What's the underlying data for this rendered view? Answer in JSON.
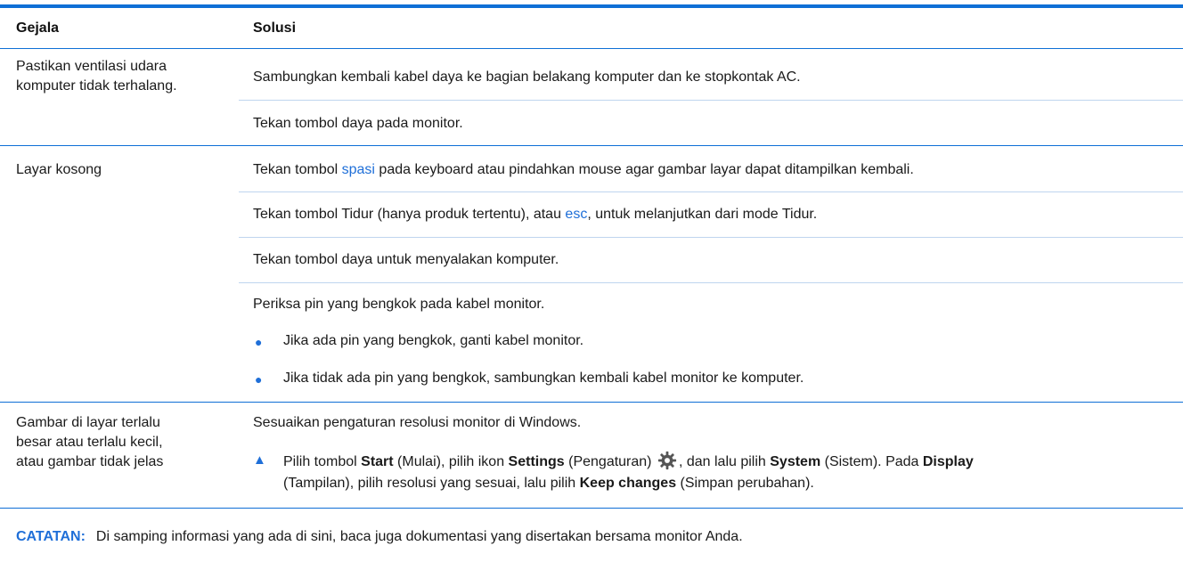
{
  "table": {
    "headers": {
      "col1": "Gejala",
      "col2": "Solusi"
    },
    "row1": {
      "symptom_l1": "Pastikan ventilasi udara",
      "symptom_l2": "komputer tidak terhalang.",
      "sol1": "Sambungkan kembali kabel daya ke bagian belakang komputer dan ke stopkontak AC.",
      "sol2": "Tekan tombol daya pada monitor."
    },
    "row2": {
      "symptom": "Layar kosong",
      "sol1_pre": "Tekan tombol ",
      "sol1_key": "spasi",
      "sol1_post": " pada keyboard atau pindahkan mouse agar gambar layar dapat ditampilkan kembali.",
      "sol2_pre": "Tekan tombol Tidur (hanya produk tertentu), atau ",
      "sol2_key": "esc",
      "sol2_post": ", untuk melanjutkan dari mode Tidur.",
      "sol3": "Tekan tombol daya untuk menyalakan komputer.",
      "sol4": "Periksa pin yang bengkok pada kabel monitor.",
      "bullet1": "Jika ada pin yang bengkok, ganti kabel monitor.",
      "bullet2": "Jika tidak ada pin yang bengkok, sambungkan kembali kabel monitor ke komputer."
    },
    "row3": {
      "symptom_l1": "Gambar di layar terlalu",
      "symptom_l2": "besar atau terlalu kecil,",
      "symptom_l3": "atau gambar tidak jelas",
      "sol1": "Sesuaikan pengaturan resolusi monitor di Windows.",
      "step": {
        "t1": "Pilih tombol ",
        "b1": "Start",
        "t2": " (Mulai), pilih ikon ",
        "b2": "Settings",
        "t3": " (Pengaturan) ",
        "t4": ", dan lalu pilih ",
        "b3": "System",
        "t5": " (Sistem). Pada ",
        "b4": "Display",
        "t6": "(Tampilan), pilih resolusi yang sesuai, lalu pilih ",
        "b5": "Keep changes",
        "t7": " (Simpan perubahan)."
      }
    }
  },
  "note": {
    "label": "CATATAN:",
    "text": "Di samping informasi yang ada di sini, baca juga dokumentasi yang disertakan bersama monitor Anda."
  },
  "icons": {
    "bullet": "●",
    "step_marker": "▲",
    "settings": "gear-icon"
  },
  "colors": {
    "accent": "#0e6fd6",
    "link": "#1f6fd8"
  }
}
